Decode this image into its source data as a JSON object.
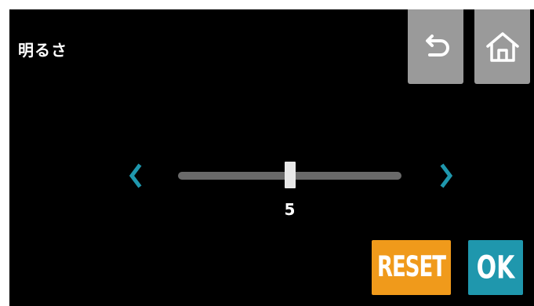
{
  "header": {
    "title": "明るさ",
    "back_icon": "back-arrow-icon",
    "home_icon": "home-icon",
    "button_color": "#9a9a9a"
  },
  "brightness": {
    "value": "5",
    "min": 0,
    "max": 10,
    "level": 5,
    "decrease_icon": "chevron-left-icon",
    "increase_icon": "chevron-right-icon",
    "arrow_color": "#1f97ad"
  },
  "actions": {
    "reset_label": "RESET",
    "ok_label": "OK",
    "reset_color": "#f09a1b",
    "ok_color": "#1f97ad"
  }
}
